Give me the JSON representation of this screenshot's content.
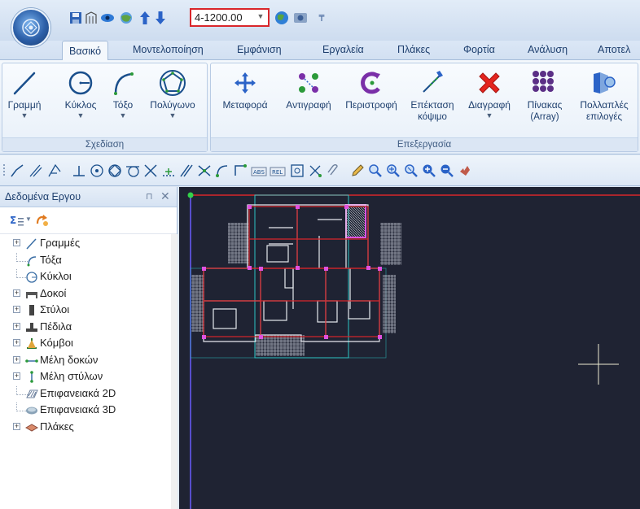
{
  "quick_access": {
    "scale_value": "4-1200.00",
    "icons": [
      "save-icon",
      "building-icon",
      "eye-icon",
      "globe-view-icon",
      "arrow-up-icon",
      "arrow-down-icon",
      "earth-icon",
      "render-icon",
      "customize-icon"
    ]
  },
  "tabs": [
    "Βασικό",
    "Μοντελοποίηση",
    "Εμφάνιση",
    "Εργαλεία",
    "Πλάκες",
    "Φορτία",
    "Ανάλυση",
    "Αποτελ"
  ],
  "ribbon": {
    "draw_group": {
      "label": "Σχεδίαση",
      "buttons": [
        "Γραμμή",
        "Κύκλος",
        "Τόξο",
        "Πολύγωνο"
      ]
    },
    "edit_group": {
      "label": "Επεξεργασία",
      "buttons": [
        "Μεταφορά",
        "Αντιγραφή",
        "Περιστροφή",
        "Επέκταση",
        "Διαγραφή",
        "Πίνακας",
        "Πολλαπλές"
      ],
      "sublabels": [
        "κόψιμο",
        "(Array)",
        "επιλογές"
      ]
    }
  },
  "panel": {
    "title": "Δεδομένα Εργου",
    "pin": "⊓",
    "close": "✕",
    "tree": [
      {
        "label": "Γραμμές",
        "expandable": true,
        "icon": "line-icon"
      },
      {
        "label": "Τόξα",
        "expandable": false,
        "icon": "arc-icon"
      },
      {
        "label": "Κύκλοι",
        "expandable": false,
        "icon": "circle-icon"
      },
      {
        "label": "Δοκοί",
        "expandable": true,
        "icon": "beam-icon"
      },
      {
        "label": "Στύλοι",
        "expandable": true,
        "icon": "column-icon"
      },
      {
        "label": "Πέδιλα",
        "expandable": true,
        "icon": "footing-icon"
      },
      {
        "label": "Κόμβοι",
        "expandable": true,
        "icon": "node-icon"
      },
      {
        "label": "Μέλη δοκών",
        "expandable": true,
        "icon": "beam-member-icon"
      },
      {
        "label": "Μέλη στύλων",
        "expandable": true,
        "icon": "column-member-icon"
      },
      {
        "label": "Επιφανειακά 2D",
        "expandable": false,
        "icon": "surface-2d-icon"
      },
      {
        "label": "Επιφανειακά 3D",
        "expandable": false,
        "icon": "surface-3d-icon"
      },
      {
        "label": "Πλάκες",
        "expandable": true,
        "icon": "slab-icon"
      }
    ]
  },
  "colors": {
    "canvas_bg": "#1f2333",
    "accent_red": "#d9262b",
    "ribbon_text": "#1e3f6e"
  }
}
